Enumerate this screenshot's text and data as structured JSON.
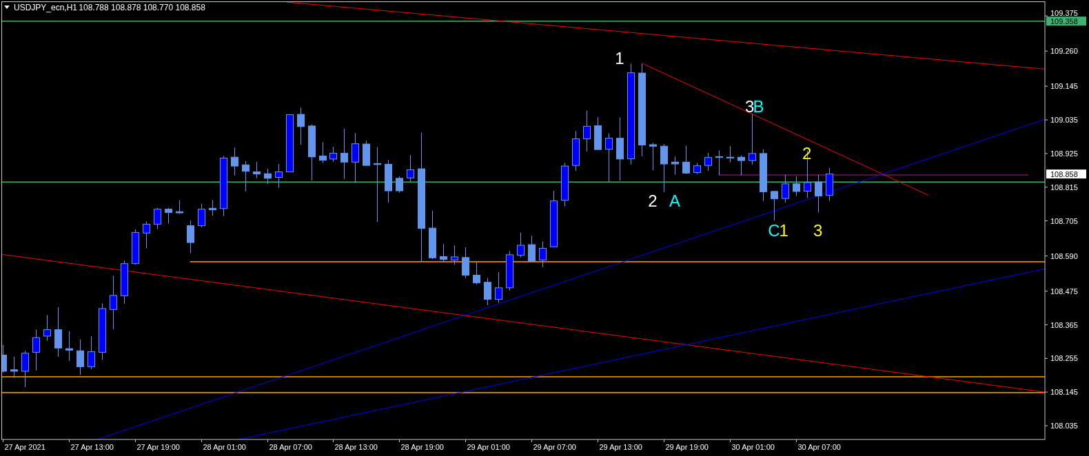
{
  "chart": {
    "symbol": "USDJPY_ecn,H1",
    "quote": [
      "108.788",
      "108.878",
      "108.770",
      "108.858"
    ],
    "price_axis": [
      "109.375",
      "109.260",
      "109.145",
      "109.035",
      "108.925",
      "108.815",
      "108.705",
      "108.590",
      "108.475",
      "108.365",
      "108.255",
      "108.145",
      "108.035"
    ],
    "time_axis": [
      "27 Apr 2021",
      "27 Apr 13:00",
      "27 Apr 19:00",
      "28 Apr 01:00",
      "28 Apr 07:00",
      "28 Apr 13:00",
      "28 Apr 19:00",
      "29 Apr 01:00",
      "29 Apr 07:00",
      "29 Apr 13:00",
      "29 Apr 19:00",
      "30 Apr 01:00",
      "30 Apr 07:00"
    ],
    "wave_labels": [
      {
        "text": "1",
        "color": "#ffffff"
      },
      {
        "text": "2",
        "color": "#ffffff"
      },
      {
        "text": "A",
        "color": "#00ffff"
      },
      {
        "text": "3",
        "color": "#ffffff"
      },
      {
        "text": "B",
        "color": "#00ffff"
      },
      {
        "text": "2",
        "color": "#ffff00"
      },
      {
        "text": "C",
        "color": "#00ffff"
      },
      {
        "text": "1",
        "color": "#ffff00"
      },
      {
        "text": "3",
        "color": "#ffff00"
      }
    ],
    "price_tags": [
      {
        "text": "109.358",
        "color": "#3cb371"
      },
      {
        "text": "108.858",
        "color": "#ffffff"
      }
    ]
  }
}
